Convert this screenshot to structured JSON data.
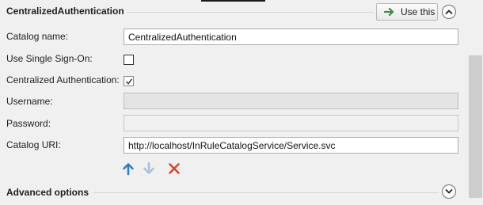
{
  "section": {
    "title": "CentralizedAuthentication",
    "use_this_label": "Use this"
  },
  "form": {
    "catalog_name_label": "Catalog name:",
    "catalog_name_value": "CentralizedAuthentication",
    "single_sign_on_label": "Use Single Sign-On:",
    "single_sign_on_checked": false,
    "centralized_auth_label": "Centralized Authentication:",
    "centralized_auth_checked": true,
    "username_label": "Username:",
    "username_value": "",
    "password_label": "Password:",
    "password_value": "",
    "catalog_uri_label": "Catalog URI:",
    "catalog_uri_value": "http://localhost/InRuleCatalogService/Service.svc"
  },
  "toolbar": {
    "icons": [
      "arrow-up-icon",
      "arrow-down-icon",
      "delete-icon"
    ]
  },
  "advanced": {
    "title": "Advanced options"
  },
  "colors": {
    "up_arrow": "#3a7bbf",
    "down_arrow": "#a9c2dd",
    "delete": "#d9452e",
    "use_arrow": "#3d8c40"
  }
}
